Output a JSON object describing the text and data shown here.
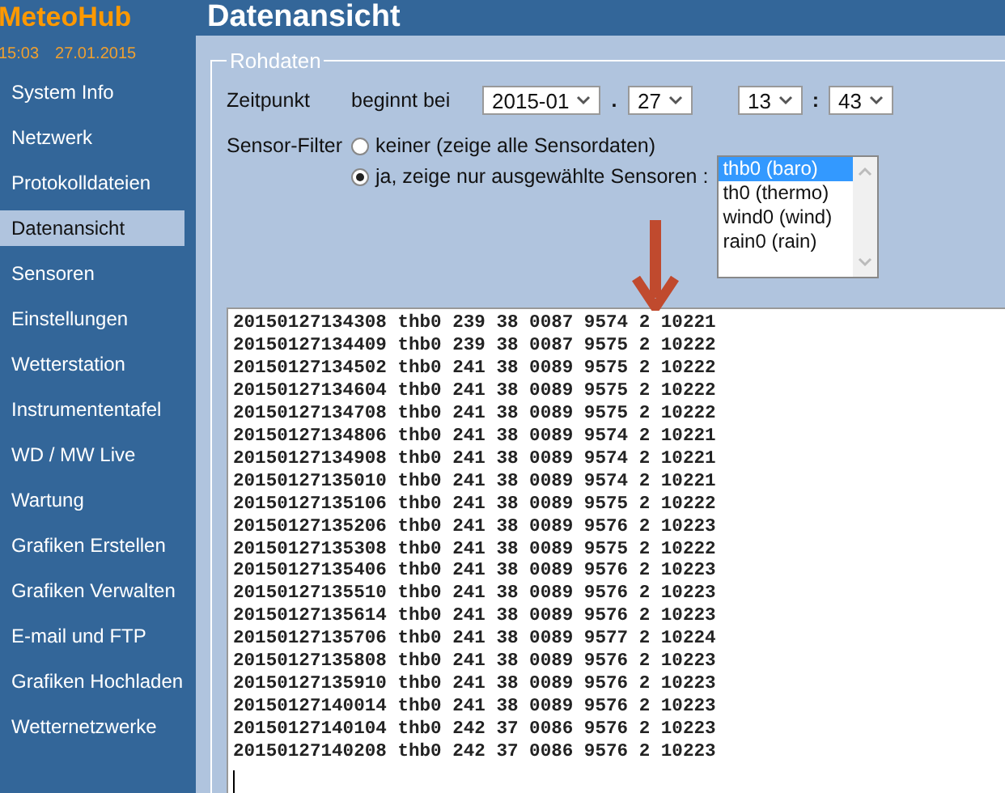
{
  "app": {
    "title": "MeteoHub",
    "time": "15:03",
    "date": "27.01.2015"
  },
  "sidebar": {
    "items": [
      {
        "label": "System Info",
        "selected": false
      },
      {
        "label": "Netzwerk",
        "selected": false
      },
      {
        "label": "Protokolldateien",
        "selected": false
      },
      {
        "label": "Datenansicht",
        "selected": true
      },
      {
        "label": "Sensoren",
        "selected": false
      },
      {
        "label": "Einstellungen",
        "selected": false
      },
      {
        "label": "Wetterstation",
        "selected": false
      },
      {
        "label": "Instrumententafel",
        "selected": false
      },
      {
        "label": "WD / MW Live",
        "selected": false
      },
      {
        "label": "Wartung",
        "selected": false
      },
      {
        "label": "Grafiken Erstellen",
        "selected": false
      },
      {
        "label": "Grafiken Verwalten",
        "selected": false
      },
      {
        "label": "E-mail und FTP",
        "selected": false
      },
      {
        "label": "Grafiken Hochladen",
        "selected": false
      },
      {
        "label": "Wetternetzwerke",
        "selected": false
      }
    ]
  },
  "page": {
    "title": "Datenansicht"
  },
  "fieldset": {
    "legend": "Rohdaten",
    "time_label": "Zeitpunkt",
    "begin_label": "beginnt bei",
    "month": "2015-01",
    "date_sep": ".",
    "day": "27",
    "hour": "13",
    "time_sep": ":",
    "minute": "43",
    "filter_label": "Sensor-Filter",
    "filter_options": [
      {
        "label": "keiner (zeige alle Sensordaten)",
        "selected": false
      },
      {
        "label": "ja, zeige nur ausgewählte Sensoren :",
        "selected": true
      }
    ],
    "sensors": [
      {
        "label": "thb0 (baro)",
        "selected": true
      },
      {
        "label": "th0 (thermo)",
        "selected": false
      },
      {
        "label": "wind0 (wind)",
        "selected": false
      },
      {
        "label": "rain0 (rain)",
        "selected": false
      }
    ]
  },
  "data_lines": [
    "20150127134308 thb0 239 38 0087 9574 2 10221",
    "20150127134409 thb0 239 38 0087 9575 2 10222",
    "20150127134502 thb0 241 38 0089 9575 2 10222",
    "20150127134604 thb0 241 38 0089 9575 2 10222",
    "20150127134708 thb0 241 38 0089 9575 2 10222",
    "20150127134806 thb0 241 38 0089 9574 2 10221",
    "20150127134908 thb0 241 38 0089 9574 2 10221",
    "20150127135010 thb0 241 38 0089 9574 2 10221",
    "20150127135106 thb0 241 38 0089 9575 2 10222",
    "20150127135206 thb0 241 38 0089 9576 2 10223",
    "20150127135308 thb0 241 38 0089 9575 2 10222",
    "20150127135406 thb0 241 38 0089 9576 2 10223",
    "20150127135510 thb0 241 38 0089 9576 2 10223",
    "20150127135614 thb0 241 38 0089 9576 2 10223",
    "20150127135706 thb0 241 38 0089 9577 2 10224",
    "20150127135808 thb0 241 38 0089 9576 2 10223",
    "20150127135910 thb0 241 38 0089 9576 2 10223",
    "20150127140014 thb0 241 38 0089 9576 2 10223",
    "20150127140104 thb0 242 37 0086 9576 2 10223",
    "20150127140208 thb0 242 37 0086 9576 2 10223"
  ]
}
